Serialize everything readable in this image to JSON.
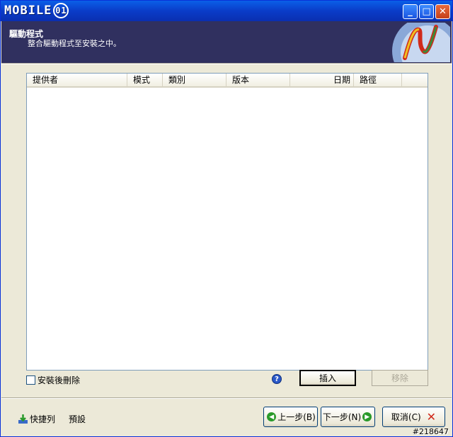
{
  "titlebar": {
    "logo_text": "MOBILE",
    "logo_badge": "01",
    "minimize": "_",
    "maximize": "□",
    "close": "✕"
  },
  "header": {
    "title": "驅動程式",
    "subtitle": "整合驅動程式至安裝之中。"
  },
  "table": {
    "columns": [
      "提供者",
      "模式",
      "類別",
      "版本",
      "日期",
      "路徑"
    ],
    "rows": []
  },
  "options": {
    "delete_after_install_label": "安裝後刪除",
    "delete_after_install_checked": false
  },
  "buttons": {
    "help": "?",
    "insert": "插入",
    "remove": "移除",
    "back": "上一步(B)",
    "next": "下一步(N)",
    "cancel": "取消(C)"
  },
  "footer": {
    "quickbar": "快捷列",
    "preset": "預設"
  },
  "watermark": "#218647",
  "icons": [
    "minimize-icon",
    "maximize-icon",
    "close-icon",
    "help-icon",
    "back-arrow-icon",
    "next-arrow-icon",
    "cancel-x-icon",
    "quickbar-download-icon"
  ]
}
